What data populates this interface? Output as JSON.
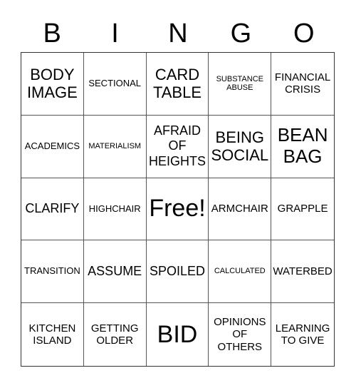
{
  "header": {
    "letters": [
      "B",
      "I",
      "N",
      "G",
      "O"
    ]
  },
  "grid": {
    "cells": [
      [
        "BODY IMAGE",
        "SECTIONAL",
        "CARD TABLE",
        "SUBSTANCE ABUSE",
        "FINANCIAL CRISIS"
      ],
      [
        "ACADEMICS",
        "MATERIALISM",
        "AFRAID OF HEIGHTS",
        "BEING SOCIAL",
        "BEAN BAG"
      ],
      [
        "CLARIFY",
        "HIGHCHAIR",
        "Free!",
        "ARMCHAIR",
        "GRAPPLE"
      ],
      [
        "TRANSITION",
        "ASSUME",
        "SPOILED",
        "CALCULATED",
        "WATERBED"
      ],
      [
        "KITCHEN ISLAND",
        "GETTING OLDER",
        "BID",
        "OPINIONS OF OTHERS",
        "LEARNING TO GIVE"
      ]
    ],
    "free_space": "Free!"
  }
}
